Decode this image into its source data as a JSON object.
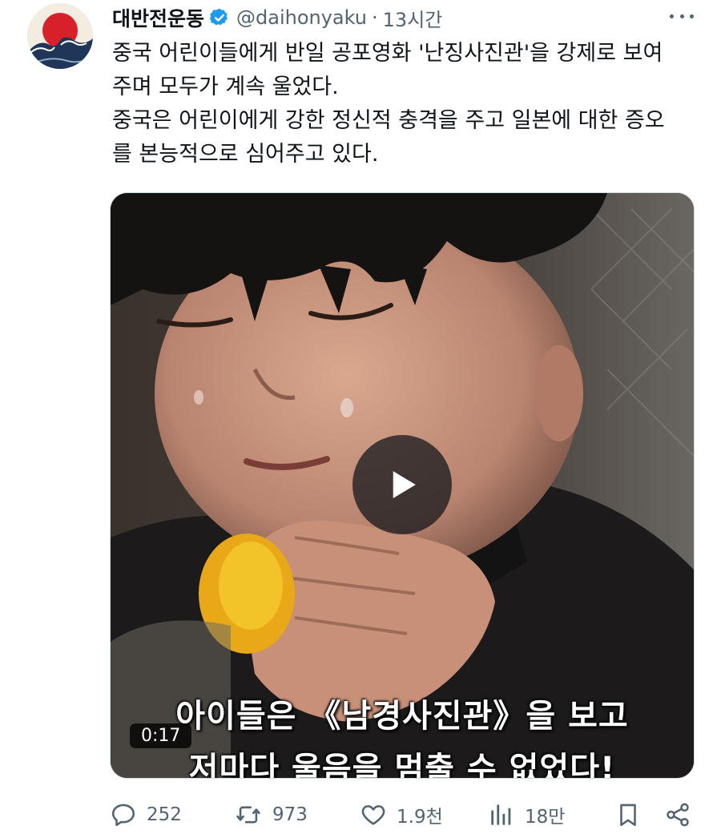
{
  "author": {
    "display_name": "대반전운동",
    "handle": "@daihonyaku",
    "separator": "·",
    "time": "13시간",
    "avatar_icon": "great-wave-avatar-icon",
    "verified_icon": "verified-badge-icon",
    "verified_color": "#1d9bf0"
  },
  "post": {
    "lines": [
      "중국 어린이들에게 반일 공포영화 '난징사진관'을 강제로 보여",
      "주며 모두가 계속 울었다.",
      "중국은 어린이에게 강한 정신적 충격을 주고 일본에 대한 증오",
      "를 본능적으로 심어주고 있다."
    ]
  },
  "video": {
    "caption_line1": "아이들은 《남경사진관》을 보고",
    "caption_line2": "저마다 울음을 멈출 수 없었다!",
    "duration": "0:17",
    "play_icon": "play-icon"
  },
  "actions": {
    "replies": {
      "icon": "reply-icon",
      "count": "252"
    },
    "reposts": {
      "icon": "repost-icon",
      "count": "973"
    },
    "likes": {
      "icon": "heart-icon",
      "count": "1.9천"
    },
    "views": {
      "icon": "views-chart-icon",
      "count": "18만"
    },
    "bookmark": {
      "icon": "bookmark-icon"
    },
    "share": {
      "icon": "share-icon"
    }
  },
  "colors": {
    "text_primary": "#0f1419",
    "text_secondary": "#536471",
    "border": "#cfd9de"
  }
}
